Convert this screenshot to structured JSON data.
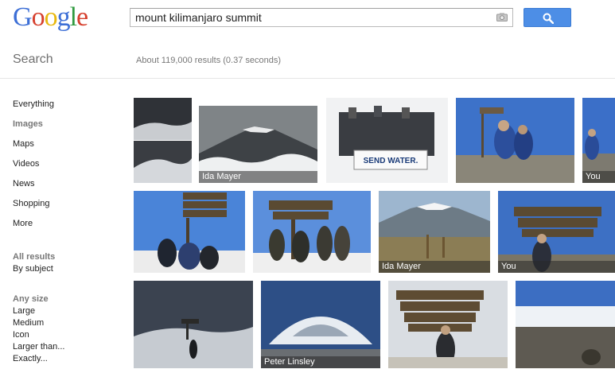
{
  "header": {
    "logo_letters": [
      "G",
      "o",
      "o",
      "g",
      "l",
      "e"
    ],
    "search_value": "mount kilimanjaro summit"
  },
  "subheader": {
    "search_label": "Search",
    "result_stats": "About 119,000 results (0.37 seconds)"
  },
  "nav": {
    "everything": "Everything",
    "images": "Images",
    "maps": "Maps",
    "videos": "Videos",
    "news": "News",
    "shopping": "Shopping",
    "more": "More",
    "all_results": "All results",
    "by_subject": "By subject",
    "any_size": "Any size",
    "large": "Large",
    "medium": "Medium",
    "icon": "Icon",
    "larger_than": "Larger than...",
    "exactly": "Exactly..."
  },
  "captions": {
    "r1c2": "Ida Mayer",
    "r1c5": "You",
    "r2c3": "Ida Mayer",
    "r2c4": "You",
    "r3c2": "Peter Linsley"
  },
  "banner_text": "SEND WATER.",
  "colors": {
    "link": "#222222",
    "muted": "#777777",
    "button": "#4d8ee6",
    "caption_bg": "rgba(40,40,40,0.55)"
  }
}
